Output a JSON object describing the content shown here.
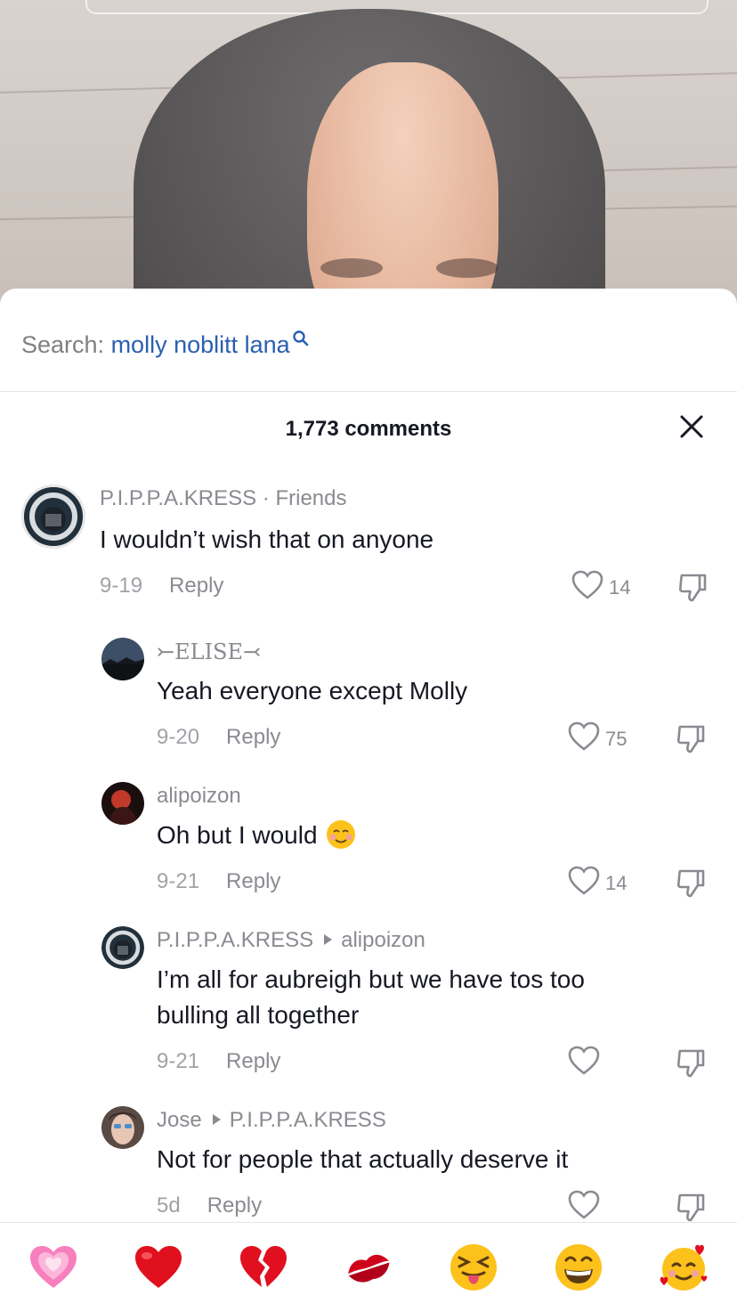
{
  "search": {
    "label": "Search: ",
    "term": "molly noblitt lana"
  },
  "comments_header": {
    "count_text": "1,773 comments"
  },
  "comments": [
    {
      "username": "P.I.P.P.A.KRESS",
      "tag": " · Friends",
      "text": "I wouldn’t wish that on anyone",
      "date": "9-19",
      "reply_label": "Reply",
      "likes": "14"
    },
    {
      "username": "⤚ELISE⤙",
      "text": "Yeah everyone except Molly",
      "date": "9-20",
      "reply_label": "Reply",
      "likes": "75"
    },
    {
      "username": "alipoizon",
      "text": "Oh but I would",
      "emoji": "smiling-face-emoji",
      "date": "9-21",
      "reply_label": "Reply",
      "likes": "14"
    },
    {
      "username": "P.I.P.P.A.KRESS",
      "reply_to": "alipoizon",
      "text_line1": "I’m all for aubreigh but we have tos too",
      "text_line2": "bulling all together",
      "date": "9-21",
      "reply_label": "Reply",
      "likes": ""
    },
    {
      "username": "Jose",
      "reply_to": "P.I.P.P.A.KRESS",
      "text": "Not for people that actually deserve it",
      "date": "5d",
      "reply_label": "Reply",
      "likes": ""
    }
  ],
  "emoji_bar": [
    "growing-heart-emoji",
    "red-heart-emoji",
    "broken-heart-emoji",
    "kiss-mark-emoji",
    "squinting-tongue-emoji",
    "grinning-emoji",
    "smiling-hearts-emoji"
  ],
  "colors": {
    "search_term": "#2a5fb0",
    "text_primary": "#161823",
    "text_secondary": "#8a8b91"
  }
}
